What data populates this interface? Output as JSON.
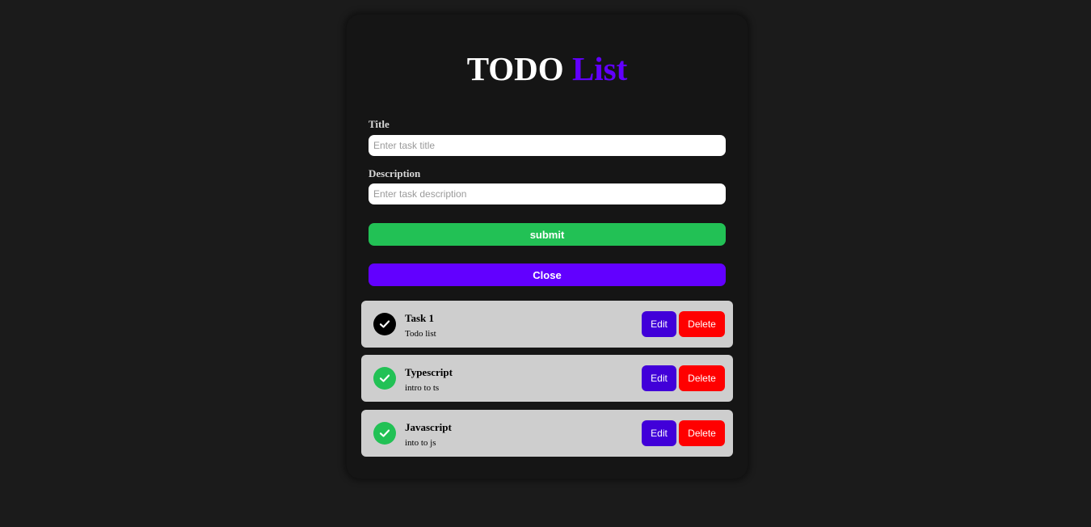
{
  "header": {
    "title_main": "TODO",
    "title_accent": "List"
  },
  "form": {
    "title_label": "Title",
    "title_placeholder": "Enter task title",
    "title_value": "",
    "description_label": "Description",
    "description_placeholder": "Enter task description",
    "description_value": "",
    "submit_label": "submit",
    "close_label": "Close"
  },
  "tasks": [
    {
      "title": "Task 1",
      "description": "Todo list",
      "completed": false,
      "edit_label": "Edit",
      "delete_label": "Delete"
    },
    {
      "title": "Typescript",
      "description": "intro to ts",
      "completed": true,
      "edit_label": "Edit",
      "delete_label": "Delete"
    },
    {
      "title": "Javascript",
      "description": "into to js",
      "completed": true,
      "edit_label": "Edit",
      "delete_label": "Delete"
    }
  ],
  "colors": {
    "accent": "#6200ff",
    "submit": "#22c155",
    "edit": "#4100d9",
    "delete": "#ff0000",
    "check_completed": "#22c155",
    "check_pending": "#000000"
  },
  "icons": {
    "check": "check-circle-icon"
  }
}
